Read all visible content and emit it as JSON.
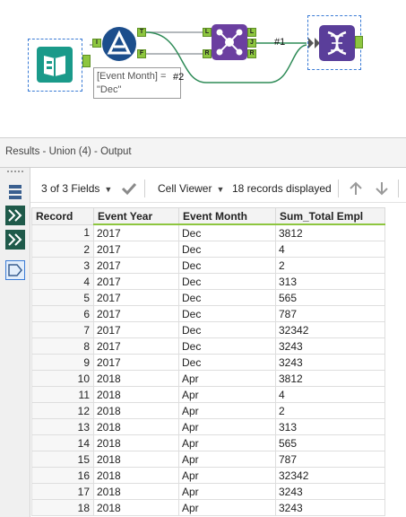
{
  "canvas": {
    "filter_expression_line1": "[Event Month] = \"Dec\"",
    "filter_expression_field": "[Event Month]",
    "filter_expression_op": "=",
    "filter_expression_value": "\"Dec\"",
    "connection_label_1": "#1",
    "connection_label_2": "#2",
    "filter_anchor_true": "T",
    "filter_anchor_false": "F",
    "input_anchor": "I",
    "join_anchor_left_in": "L",
    "join_anchor_right_in": "R",
    "join_anchor_left_out": "L",
    "join_anchor_join_out": "J",
    "join_anchor_right_out": "R",
    "colors": {
      "input_tool": "#1a9a8a",
      "filter_tool": "#1c4e8c",
      "join_tool": "#6b3fa0",
      "union_tool": "#5a3e9a",
      "anchor": "#8dc63f",
      "connection": "#2e8b57"
    }
  },
  "results": {
    "title": "Results - Union (4) - Output",
    "fields_selector": "3 of 3 Fields",
    "viewer_selector": "Cell Viewer",
    "records_displayed": "18 records displayed"
  },
  "grid": {
    "columns": [
      "Record",
      "Event Year",
      "Event Month",
      "Sum_Total Empl"
    ],
    "rows": [
      [
        "1",
        "2017",
        "Dec",
        "3812"
      ],
      [
        "2",
        "2017",
        "Dec",
        "4"
      ],
      [
        "3",
        "2017",
        "Dec",
        "2"
      ],
      [
        "4",
        "2017",
        "Dec",
        "313"
      ],
      [
        "5",
        "2017",
        "Dec",
        "565"
      ],
      [
        "6",
        "2017",
        "Dec",
        "787"
      ],
      [
        "7",
        "2017",
        "Dec",
        "32342"
      ],
      [
        "8",
        "2017",
        "Dec",
        "3243"
      ],
      [
        "9",
        "2017",
        "Dec",
        "3243"
      ],
      [
        "10",
        "2018",
        "Apr",
        "3812"
      ],
      [
        "11",
        "2018",
        "Apr",
        "4"
      ],
      [
        "12",
        "2018",
        "Apr",
        "2"
      ],
      [
        "13",
        "2018",
        "Apr",
        "313"
      ],
      [
        "14",
        "2018",
        "Apr",
        "565"
      ],
      [
        "15",
        "2018",
        "Apr",
        "787"
      ],
      [
        "16",
        "2018",
        "Apr",
        "32342"
      ],
      [
        "17",
        "2018",
        "Apr",
        "3243"
      ],
      [
        "18",
        "2018",
        "Apr",
        "3243"
      ]
    ]
  }
}
